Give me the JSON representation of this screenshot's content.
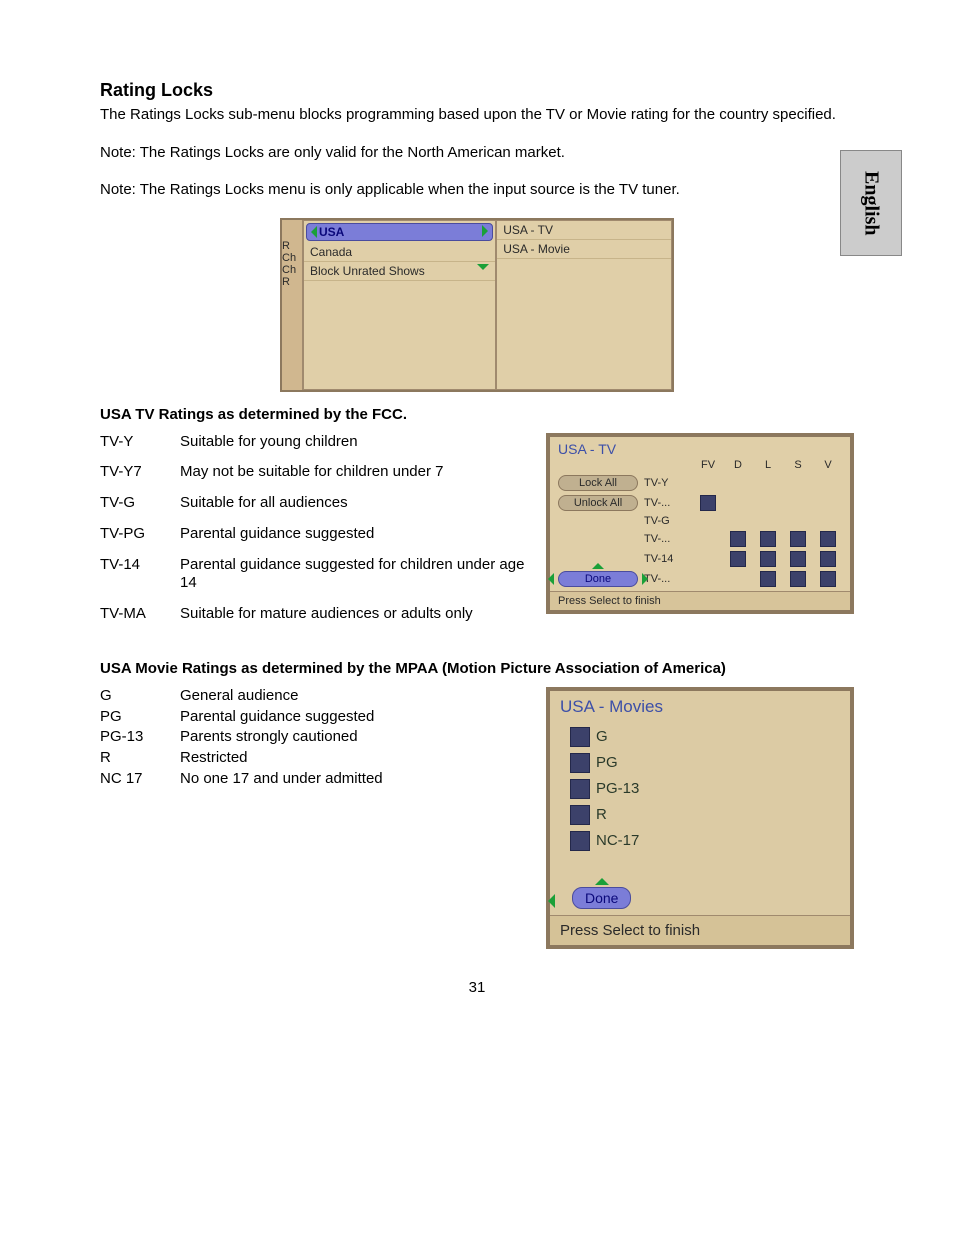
{
  "lang_tab": "English",
  "title": "Rating Locks",
  "para1": "The Ratings Locks sub-menu blocks programming based upon the TV or Movie rating for the country specified.",
  "para2": "Note: The Ratings Locks are only valid for the North American market.",
  "para3": "Note: The Ratings Locks menu is only applicable when the input source is the TV tuner.",
  "menu1": {
    "left_hints": [
      "R",
      "Ch",
      "Ch",
      "R"
    ],
    "left_panel": {
      "selected": "USA",
      "items": [
        "Canada",
        "Block Unrated Shows"
      ]
    },
    "right_panel": {
      "items": [
        "USA - TV",
        "USA - Movie"
      ]
    }
  },
  "sub_hdr_tv": "USA TV Ratings as determined by the FCC",
  "tv_ratings": [
    {
      "code": "TV-Y",
      "desc": "Suitable for young children"
    },
    {
      "code": "TV-Y7",
      "desc": "May not be suitable for children under 7"
    },
    {
      "code": "TV-G",
      "desc": "Suitable for all audiences"
    },
    {
      "code": "TV-PG",
      "desc": "Parental guidance suggested"
    },
    {
      "code": "TV-14",
      "desc": "Parental guidance suggested for children under age 14"
    },
    {
      "code": "TV-MA",
      "desc": "Suitable for mature audiences or adults only"
    }
  ],
  "tv_panel": {
    "title": "USA - TV",
    "columns": [
      "FV",
      "D",
      "L",
      "S",
      "V"
    ],
    "lock_all": "Lock All",
    "unlock_all": "Unlock All",
    "done": "Done",
    "rows": [
      {
        "label": "TV-Y",
        "boxes": [
          false,
          false,
          false,
          false,
          false
        ]
      },
      {
        "label": "TV-...",
        "boxes": [
          true,
          false,
          false,
          false,
          false
        ]
      },
      {
        "label": "TV-G",
        "boxes": [
          false,
          false,
          false,
          false,
          false
        ]
      },
      {
        "label": "TV-...",
        "boxes": [
          false,
          true,
          true,
          true,
          true
        ]
      },
      {
        "label": "TV-14",
        "boxes": [
          false,
          true,
          true,
          true,
          true
        ]
      },
      {
        "label": "TV-...",
        "boxes": [
          false,
          false,
          true,
          true,
          true
        ]
      }
    ],
    "footer": "Press Select to finish"
  },
  "sub_hdr_movie": "USA Movie Ratings as determined by the MPAA (Motion Picture Association of America)",
  "movie_ratings": [
    {
      "code": "G",
      "desc": "General audience"
    },
    {
      "code": "PG",
      "desc": "Parental guidance suggested"
    },
    {
      "code": "PG-13",
      "desc": "Parents strongly cautioned"
    },
    {
      "code": "R",
      "desc": "Restricted"
    },
    {
      "code": "NC 17",
      "desc": "No one 17 and under admitted"
    }
  ],
  "movie_panel": {
    "title": "USA - Movies",
    "rows": [
      "G",
      "PG",
      "PG-13",
      "R",
      "NC-17"
    ],
    "done": "Done",
    "footer": "Press Select to finish"
  },
  "page_number": "31"
}
